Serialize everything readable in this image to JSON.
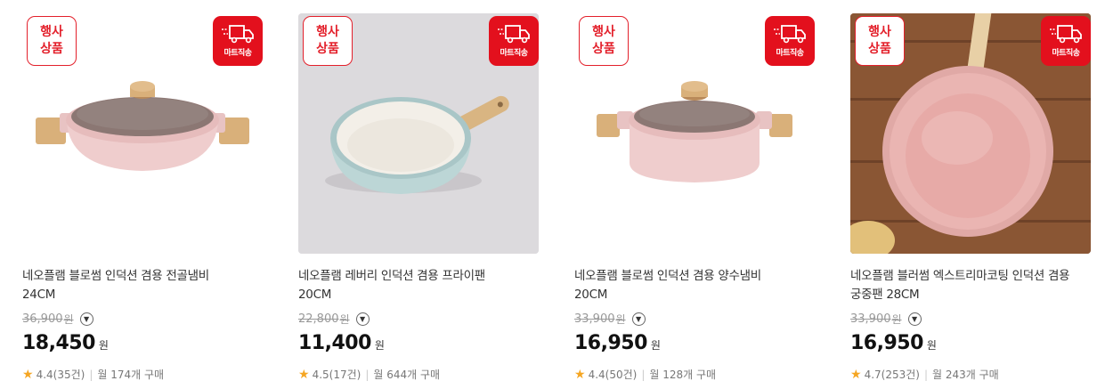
{
  "badges": {
    "event_line1": "행사",
    "event_line2": "상품",
    "mart_delivery": "마트직송"
  },
  "currency": "원",
  "products": [
    {
      "name_line1": "네오플램 블로썸 인덕션 겸용 전골냄비",
      "name_line2": "24CM",
      "original_price": "36,900",
      "price": "18,450",
      "rating": "4.4",
      "reviews": "(35건)",
      "monthly": "월 174개 구매"
    },
    {
      "name_line1": "네오플램 레버리 인덕션 겸용 프라이팬",
      "name_line2": "20CM",
      "original_price": "22,800",
      "price": "11,400",
      "rating": "4.5",
      "reviews": "(17건)",
      "monthly": "월 644개 구매"
    },
    {
      "name_line1": "네오플램 블로썸 인덕션 겸용 양수냄비",
      "name_line2": "20CM",
      "original_price": "33,900",
      "price": "16,950",
      "rating": "4.4",
      "reviews": "(50건)",
      "monthly": "월 128개 구매"
    },
    {
      "name_line1": "네오플램 블러썸 엑스트리마코팅 인덕션 겸용",
      "name_line2": "궁중팬 28CM",
      "original_price": "33,900",
      "price": "16,950",
      "rating": "4.7",
      "reviews": "(253건)",
      "monthly": "월 243개 구매"
    }
  ]
}
